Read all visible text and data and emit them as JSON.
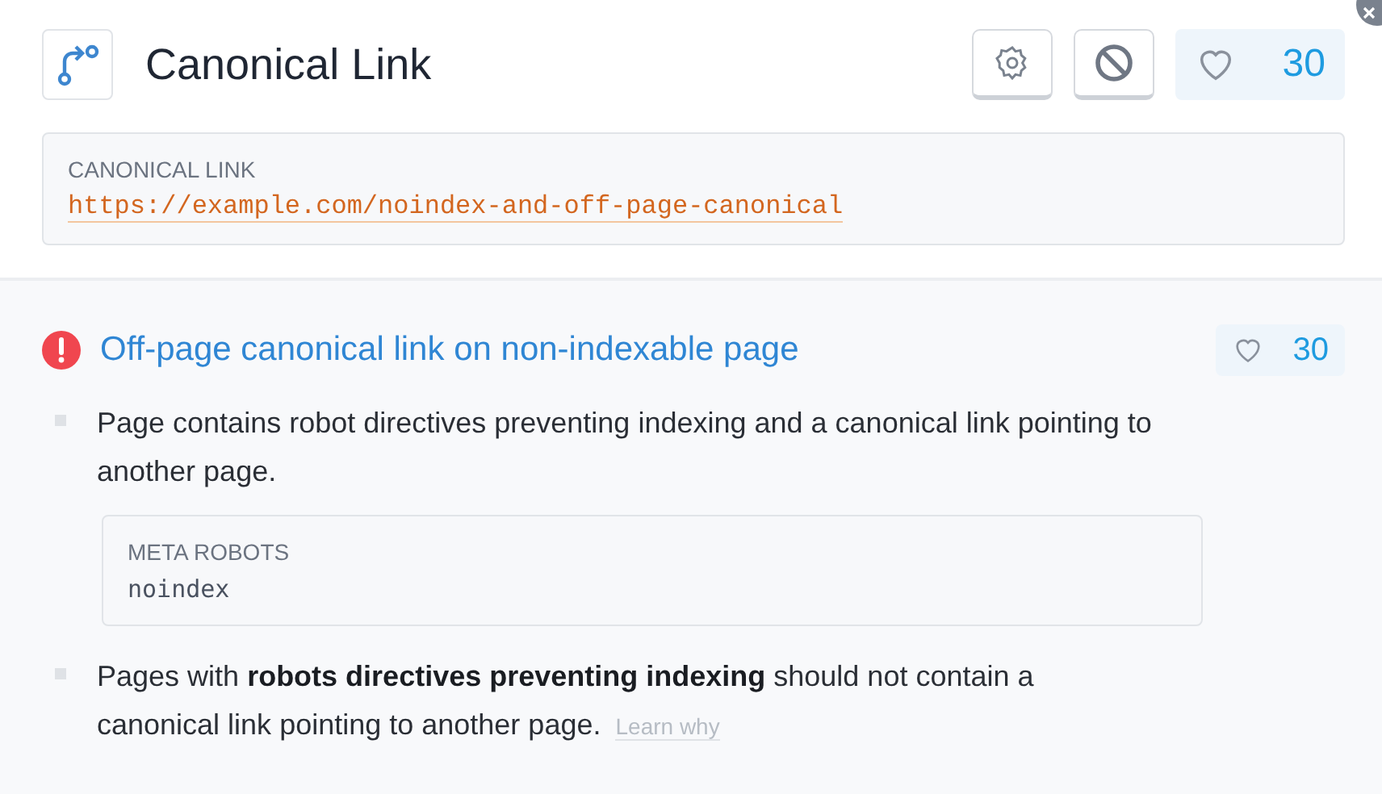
{
  "header": {
    "title": "Canonical Link",
    "likes": "30"
  },
  "canonical": {
    "label": "CANONICAL LINK",
    "url": "https://example.com/noindex-and-off-page-canonical"
  },
  "issue": {
    "kind": "error",
    "title": "Off-page canonical link on non-indexable page",
    "likes": "30",
    "bullets": [
      {
        "kind": "text",
        "text": "Page contains robot directives preventing indexing and a canonical link pointing to another page."
      },
      {
        "kind": "code",
        "label": "META ROBOTS",
        "value": "noindex"
      },
      {
        "kind": "text",
        "text": "Pages with **robots directives preventing indexing** should not contain a canonical link pointing to another page.",
        "link": "Learn why"
      }
    ]
  }
}
